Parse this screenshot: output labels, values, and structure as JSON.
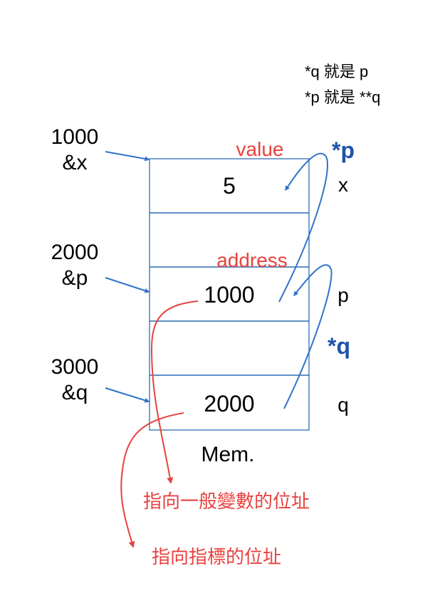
{
  "notes": {
    "line1": "*q 就是 p",
    "line2": "*p 就是 **q"
  },
  "addresses": [
    {
      "value": "1000",
      "ref": "&x"
    },
    {
      "value": "2000",
      "ref": "&p"
    },
    {
      "value": "3000",
      "ref": "&q"
    }
  ],
  "labels": {
    "value": "value",
    "address": "address",
    "deref_p": "*p",
    "deref_q": "*q",
    "memory": "Mem."
  },
  "cells": [
    "5",
    "",
    "1000",
    "",
    "2000"
  ],
  "variables": [
    "x",
    "",
    "p",
    "",
    "q"
  ],
  "captions": {
    "general_variable": "指向一般變數的位址",
    "pointer": "指向指標的位址"
  },
  "colors": {
    "blue_arrow": "#2f74c8",
    "blue_label": "#1f54a8",
    "red": "#e8423f",
    "cell_border": "#2e6db4",
    "text": "#000000"
  }
}
